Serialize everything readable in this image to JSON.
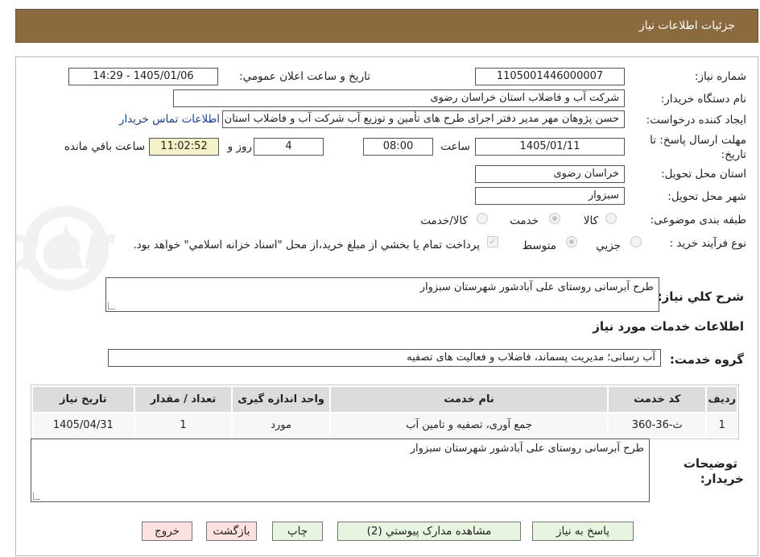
{
  "header": {
    "title": "جزئیات اطلاعات نیاز"
  },
  "fields": {
    "need_number_label": "شماره نیاز:",
    "need_number": "1105001446000007",
    "announce_label": "تاریخ و ساعت اعلان عمومي:",
    "announce_value": "1405/01/06 - 14:29",
    "buyer_org_label": "نام دستگاه خريدار:",
    "buyer_org": "شرکت آب و فاضلاب استان خراسان رضوی",
    "creator_label": "ايجاد کننده درخواست:",
    "creator": "حسن پژوهان مهر مدیر دفتر اجرای طرح های تأمین و توزیع آب  شرکت آب و فاضلاب استان خراسان رضوی",
    "contact_link": "اطلاعات تماس خريدار",
    "deadline_label_1": "مهلت ارسال پاسخ: تا",
    "deadline_label_2": "تاريخ:",
    "deadline_date": "1405/01/11",
    "time_label": "ساعت",
    "deadline_time": "08:00",
    "days_value": "4",
    "days_label": "روز و",
    "remaining_time": "11:02:52",
    "remaining_label": "ساعت باقي مانده",
    "province_label": "استان محل تحويل:",
    "province": "خراسان رضوی",
    "city_label": "شهر محل تحويل:",
    "city": "سبزوار",
    "category_label": "طبقه بندی موضوعی:",
    "category_options": [
      "کالا",
      "خدمت",
      "کالا/خدمت"
    ],
    "category_selected": "خدمت",
    "process_label": "نوع فرآيند خريد :",
    "process_options": [
      "جزيي",
      "متوسط"
    ],
    "process_selected": "متوسط",
    "payment_note": "پرداخت تمام يا بخشي از مبلغ خريد،از محل \"اسناد خزانه اسلامي\" خواهد بود."
  },
  "summary": {
    "label": "شرح کلي نياز:",
    "text": "طرح آبرسانی روستای علی آبادشور      شهرستان سبزوار"
  },
  "services": {
    "section_title": "اطلاعات خدمات مورد نياز",
    "group_label": "گروه خدمت:",
    "group_value": "آب رسانی؛ مدیریت پسماند، فاضلاب و فعالیت های تصفیه",
    "columns": [
      "رديف",
      "کد خدمت",
      "نام خدمت",
      "واحد اندازه گيری",
      "تعداد / مقدار",
      "تاريخ نياز"
    ],
    "rows": [
      [
        "1",
        "ث-36-360",
        "جمع آوری، تصفیه و تامین آب",
        "مورد",
        "1",
        "1405/04/31"
      ]
    ]
  },
  "buyer_notes": {
    "label_1": "توضيحات",
    "label_2": "خريدار:",
    "text": "طرح آبرسانی روستای علی آبادشور      شهرستان سبزوار"
  },
  "buttons": {
    "reply": "پاسخ به نياز",
    "attachments": "مشاهده مدارک پيوستي (2)",
    "print": "چاپ",
    "back": "بازگشت",
    "exit": "خروج"
  },
  "colors": {
    "header_bg": "#8b6a3e",
    "link": "#1a3fa8",
    "button_green": "#e7f5e0",
    "button_pink": "#fde0e0",
    "remaining_bg": "#f6f2c8"
  }
}
